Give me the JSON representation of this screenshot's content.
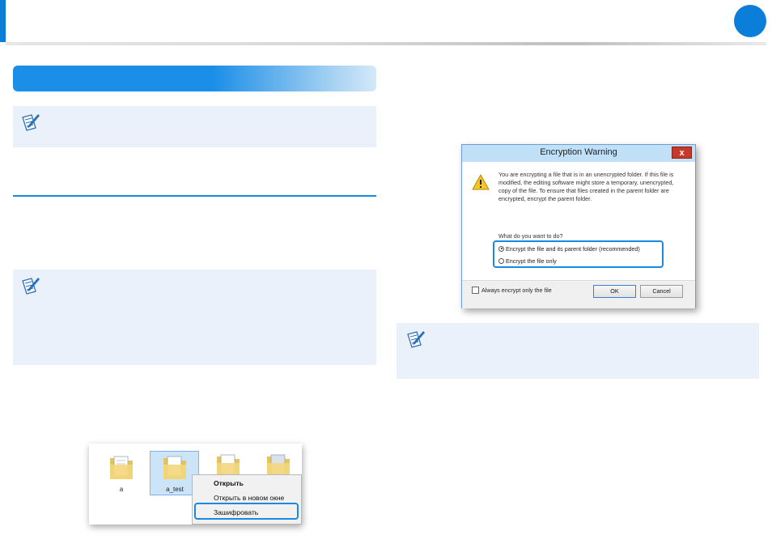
{
  "colors": {
    "accent": "#0a7ed8",
    "note_background": "#eaf1fa",
    "highlight_outline": "#1a8ae0"
  },
  "header": {
    "accent_bar": "blue-vertical-bar",
    "page_marker": "blue-circle"
  },
  "notes": [
    {
      "icon": "note-pencil-icon"
    },
    {
      "icon": "note-pencil-icon"
    },
    {
      "icon": "note-pencil-icon"
    }
  ],
  "encryption_dialog": {
    "title": "Encryption Warning",
    "close_label": "x",
    "warning_icon": "warning-triangle-icon",
    "message": "You are encrypting a file that is in an unencrypted folder. If this file is modified, the editing software might store a temporary, unencrypted, copy of the file. To ensure that files created in the parent folder are encrypted, encrypt the parent folder.",
    "question": "What do you want to do?",
    "options": [
      {
        "label": "Encrypt the file and its parent folder (recommended)",
        "selected": true
      },
      {
        "label": "Encrypt the file only",
        "selected": false
      }
    ],
    "always_label": "Always encrypt only the file",
    "always_checked": false,
    "ok_label": "OK",
    "cancel_label": "Cancel"
  },
  "explorer": {
    "files": [
      {
        "name": "a",
        "icon": "folder-icon"
      },
      {
        "name": "a_test",
        "icon": "folder-icon",
        "selected": true
      },
      {
        "name": "",
        "icon": "folder-icon"
      },
      {
        "name": "",
        "icon": "folder-icon"
      }
    ],
    "context_menu": {
      "items": [
        "Открыть",
        "Открыть в новом окне",
        "Зашифровать"
      ],
      "highlighted": "Зашифровать"
    }
  }
}
